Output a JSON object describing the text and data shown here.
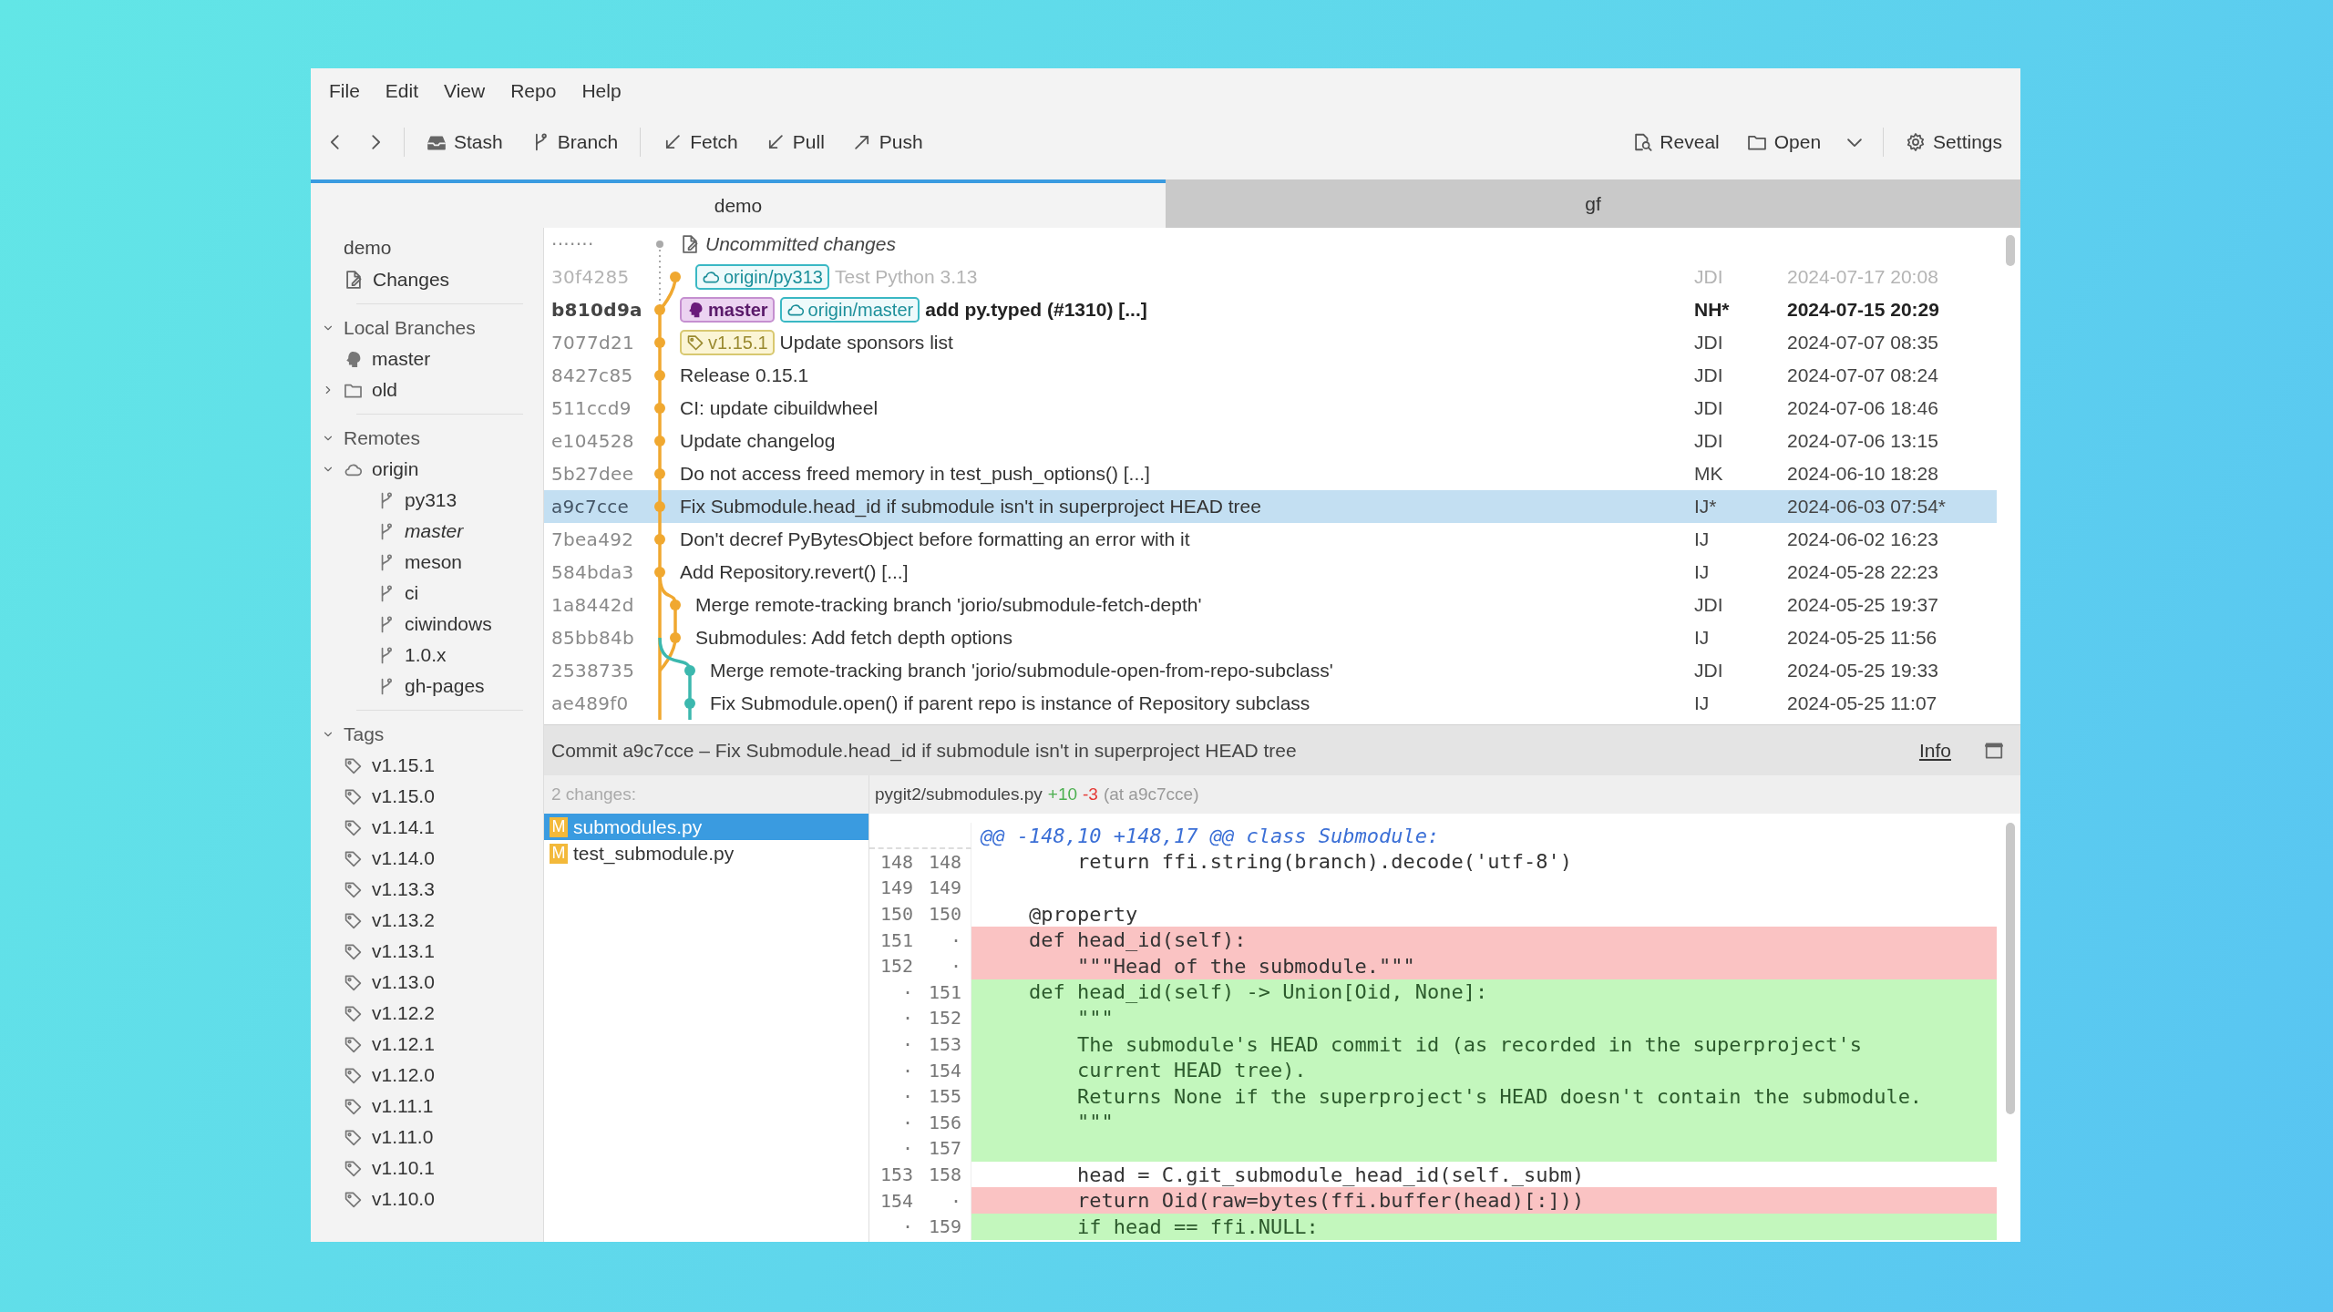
{
  "menu": [
    "File",
    "Edit",
    "View",
    "Repo",
    "Help"
  ],
  "toolbar": {
    "left": [
      {
        "kind": "back"
      },
      {
        "kind": "forward"
      },
      {
        "kind": "separator"
      },
      {
        "kind": "stash",
        "label": "Stash"
      },
      {
        "kind": "branch",
        "label": "Branch"
      },
      {
        "kind": "separator"
      },
      {
        "kind": "fetch",
        "label": "Fetch"
      },
      {
        "kind": "pull",
        "label": "Pull"
      },
      {
        "kind": "push",
        "label": "Push"
      }
    ],
    "right": [
      {
        "kind": "reveal",
        "label": "Reveal"
      },
      {
        "kind": "open",
        "label": "Open"
      },
      {
        "kind": "dropdown"
      },
      {
        "kind": "separator"
      },
      {
        "kind": "settings",
        "label": "Settings"
      }
    ]
  },
  "tabs": [
    {
      "label": "demo",
      "selected": true
    },
    {
      "label": "gf",
      "selected": false
    }
  ],
  "sidebar": {
    "repo": "demo",
    "changes": "Changes",
    "sections": [
      {
        "title": "Local Branches",
        "expanded": true,
        "items": [
          {
            "label": "master",
            "kind": "head",
            "emphasized": false
          },
          {
            "label": "old",
            "kind": "folder",
            "expanded": false,
            "emphasized": false
          }
        ]
      },
      {
        "title": "Remotes",
        "expanded": true,
        "items": [
          {
            "label": "origin",
            "kind": "remote",
            "expanded": true,
            "emphasized": false,
            "children": [
              {
                "label": "py313",
                "kind": "branch",
                "emphasized": false
              },
              {
                "label": "master",
                "kind": "branch",
                "emphasized": true
              },
              {
                "label": "meson",
                "kind": "branch",
                "emphasized": false
              },
              {
                "label": "ci",
                "kind": "branch",
                "emphasized": false
              },
              {
                "label": "ciwindows",
                "kind": "branch",
                "emphasized": false
              },
              {
                "label": "1.0.x",
                "kind": "branch",
                "emphasized": false
              },
              {
                "label": "gh-pages",
                "kind": "branch",
                "emphasized": false
              }
            ]
          }
        ]
      },
      {
        "title": "Tags",
        "expanded": true,
        "items": [
          {
            "label": "v1.15.1",
            "kind": "tag"
          },
          {
            "label": "v1.15.0",
            "kind": "tag"
          },
          {
            "label": "v1.14.1",
            "kind": "tag"
          },
          {
            "label": "v1.14.0",
            "kind": "tag"
          },
          {
            "label": "v1.13.3",
            "kind": "tag"
          },
          {
            "label": "v1.13.2",
            "kind": "tag"
          },
          {
            "label": "v1.13.1",
            "kind": "tag"
          },
          {
            "label": "v1.13.0",
            "kind": "tag"
          },
          {
            "label": "v1.12.2",
            "kind": "tag"
          },
          {
            "label": "v1.12.1",
            "kind": "tag"
          },
          {
            "label": "v1.12.0",
            "kind": "tag"
          },
          {
            "label": "v1.11.1",
            "kind": "tag"
          },
          {
            "label": "v1.11.0",
            "kind": "tag"
          },
          {
            "label": "v1.10.1",
            "kind": "tag"
          },
          {
            "label": "v1.10.0",
            "kind": "tag"
          }
        ]
      }
    ]
  },
  "commits": [
    {
      "kind": "uncommitted",
      "hash": "·······",
      "message": "Uncommitted changes",
      "selected": false,
      "current": false,
      "dimmed": false
    },
    {
      "kind": "branch",
      "hash": "30f4285",
      "refs": [
        {
          "kind": "remote",
          "label": "origin/py313"
        }
      ],
      "message": "Test Python 3.13",
      "author": "JDI",
      "date": "2024-07-17 20:08",
      "selected": false,
      "current": false,
      "dimmed": true
    },
    {
      "kind": "mainline",
      "hash": "b810d9a",
      "refs": [
        {
          "kind": "head",
          "label": "master"
        },
        {
          "kind": "remote",
          "label": "origin/master"
        }
      ],
      "message": "add py.typed (#1310) [...]",
      "author": "NH*",
      "date": "2024-07-15 20:29",
      "selected": false,
      "current": true,
      "dimmed": false
    },
    {
      "kind": "mainline",
      "hash": "7077d21",
      "refs": [
        {
          "kind": "tag",
          "label": "v1.15.1"
        }
      ],
      "message": "Update sponsors list",
      "author": "JDI",
      "date": "2024-07-07 08:35",
      "selected": false,
      "current": false,
      "dimmed": false
    },
    {
      "kind": "mainline",
      "hash": "8427c85",
      "message": "Release 0.15.1",
      "author": "JDI",
      "date": "2024-07-07 08:24",
      "selected": false,
      "current": false,
      "dimmed": false
    },
    {
      "kind": "mainline",
      "hash": "511ccd9",
      "message": "CI: update cibuildwheel",
      "author": "JDI",
      "date": "2024-07-06 18:46",
      "selected": false,
      "current": false,
      "dimmed": false
    },
    {
      "kind": "mainline",
      "hash": "e104528",
      "message": "Update changelog",
      "author": "JDI",
      "date": "2024-07-06 13:15",
      "selected": false,
      "current": false,
      "dimmed": false
    },
    {
      "kind": "mainline",
      "hash": "5b27dee",
      "message": "Do not access freed memory in test_push_options() [...]",
      "author": "MK",
      "date": "2024-06-10 18:28",
      "selected": false,
      "current": false,
      "dimmed": false
    },
    {
      "kind": "mainline",
      "hash": "a9c7cce",
      "message": "Fix Submodule.head_id if submodule isn't in superproject HEAD tree",
      "author": "IJ*",
      "date": "2024-06-03 07:54*",
      "selected": true,
      "current": false,
      "dimmed": false
    },
    {
      "kind": "mainline",
      "hash": "7bea492",
      "message": "Don't decref PyBytesObject before formatting an error with it",
      "author": "IJ",
      "date": "2024-06-02 16:23",
      "selected": false,
      "current": false,
      "dimmed": false
    },
    {
      "kind": "mainline",
      "hash": "584bda3",
      "message": "Add Repository.revert() [...]",
      "author": "IJ",
      "date": "2024-05-28 22:23",
      "selected": false,
      "current": false,
      "dimmed": false
    },
    {
      "kind": "branch",
      "hash": "1a8442d",
      "message": "Merge remote-tracking branch 'jorio/submodule-fetch-depth'",
      "author": "JDI",
      "date": "2024-05-25 19:37",
      "selected": false,
      "current": false,
      "dimmed": false
    },
    {
      "kind": "branch",
      "hash": "85bb84b",
      "message": "Submodules: Add fetch depth options",
      "author": "IJ",
      "date": "2024-05-25 11:56",
      "selected": false,
      "current": false,
      "dimmed": false
    },
    {
      "kind": "subbranch",
      "hash": "2538735",
      "message": "Merge remote-tracking branch 'jorio/submodule-open-from-repo-subclass'",
      "author": "JDI",
      "date": "2024-05-25 19:33",
      "selected": false,
      "current": false,
      "dimmed": false
    },
    {
      "kind": "subbranch",
      "hash": "ae489f0",
      "message": "Fix Submodule.open() if parent repo is instance of Repository subclass",
      "author": "IJ",
      "date": "2024-05-25 11:07",
      "selected": false,
      "current": false,
      "dimmed": false
    }
  ],
  "details": {
    "title": "Commit a9c7cce – Fix Submodule.head_id if submodule isn't in superproject HEAD tree",
    "info": "Info"
  },
  "files": {
    "count": "2 changes:",
    "items": [
      {
        "status": "M",
        "name": "submodules.py",
        "selected": true
      },
      {
        "status": "M",
        "name": "test_submodule.py",
        "selected": false
      }
    ]
  },
  "diff": {
    "path": "pygit2/submodules.py",
    "added": "+10",
    "removed": "-3",
    "at": "(at a9c7cce)",
    "lines": [
      {
        "kind": "hunk",
        "text": "@@ -148,10 +148,17 @@ class Submodule:"
      },
      {
        "kind": "context",
        "old": "148",
        "new": "148",
        "text": "        return ffi.string(branch).decode('utf-8')"
      },
      {
        "kind": "context",
        "old": "149",
        "new": "149"
      },
      {
        "kind": "context",
        "old": "150",
        "new": "150",
        "text": "    @property"
      },
      {
        "kind": "removed",
        "old": "151",
        "new": "·",
        "text": "    def head_id(self):"
      },
      {
        "kind": "removed",
        "old": "152",
        "new": "·",
        "text": "        \"\"\"Head of the submodule.\"\"\""
      },
      {
        "kind": "added",
        "old": "·",
        "new": "151",
        "text": "    def head_id(self) -> Union[Oid, None]:"
      },
      {
        "kind": "added",
        "old": "·",
        "new": "152",
        "text": "        \"\"\""
      },
      {
        "kind": "added",
        "old": "·",
        "new": "153",
        "text": "        The submodule's HEAD commit id (as recorded in the superproject's"
      },
      {
        "kind": "added",
        "old": "·",
        "new": "154",
        "text": "        current HEAD tree)."
      },
      {
        "kind": "added",
        "old": "·",
        "new": "155",
        "text": "        Returns None if the superproject's HEAD doesn't contain the submodule."
      },
      {
        "kind": "added",
        "old": "·",
        "new": "156",
        "text": "        \"\"\""
      },
      {
        "kind": "added",
        "old": "·",
        "new": "157"
      },
      {
        "kind": "context",
        "old": "153",
        "new": "158",
        "text": "        head = C.git_submodule_head_id(self._subm)"
      },
      {
        "kind": "removed",
        "old": "154",
        "new": "·",
        "text": "        return Oid(raw=bytes(ffi.buffer(head)[:]))"
      },
      {
        "kind": "added",
        "old": "·",
        "new": "159",
        "text": "        if head == ffi.NULL:"
      }
    ]
  }
}
